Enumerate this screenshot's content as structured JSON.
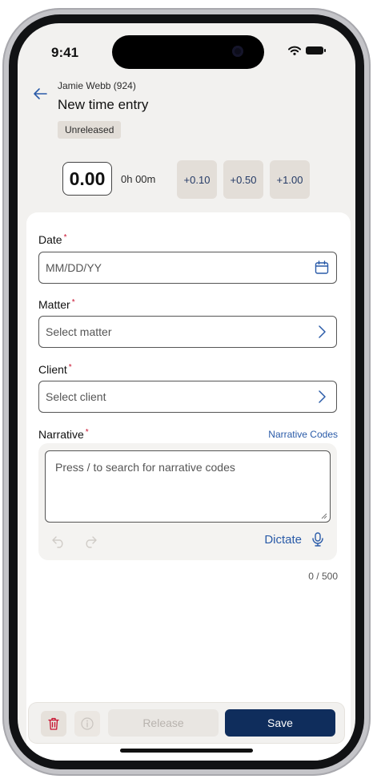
{
  "status": {
    "time": "9:41"
  },
  "header": {
    "subtitle": "Jamie Webb (924)",
    "title": "New time entry",
    "badge": "Unreleased"
  },
  "time": {
    "hours": "0.00",
    "duration": "0h 00m",
    "increments": [
      "+0.10",
      "+0.50",
      "+1.00"
    ]
  },
  "form": {
    "date": {
      "label": "Date",
      "required": "*",
      "placeholder": "MM/DD/YY",
      "icon": "calendar-icon"
    },
    "matter": {
      "label": "Matter",
      "required": "*",
      "placeholder": "Select matter",
      "icon": "chevron-right-icon"
    },
    "client": {
      "label": "Client",
      "required": "*",
      "placeholder": "Select client",
      "icon": "chevron-right-icon"
    },
    "narrative": {
      "label": "Narrative",
      "required": "*",
      "link": "Narrative Codes",
      "placeholder": "Press / to search for narrative codes",
      "dictate": "Dictate",
      "counter": "0 / 500"
    }
  },
  "footer": {
    "release_label": "Release",
    "save_label": "Save"
  },
  "colors": {
    "accent": "#0f2d5c",
    "link": "#2a5ba8",
    "required": "#c8102e",
    "delete": "#c8102e"
  }
}
